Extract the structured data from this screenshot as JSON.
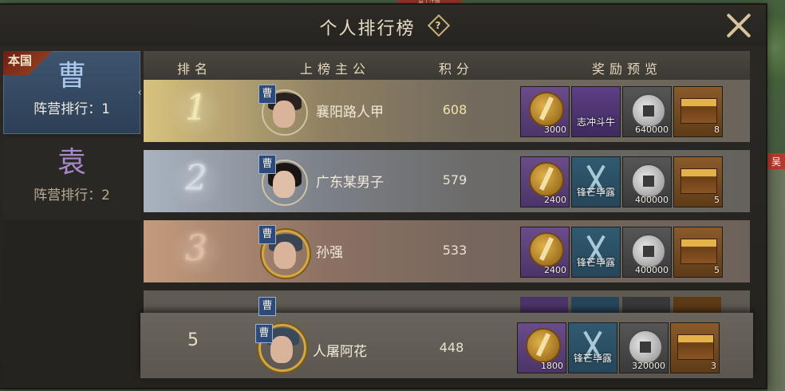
{
  "map": {
    "right_tag": "吴",
    "top_tag": "吴 | 江南"
  },
  "header": {
    "title": "个人排行榜",
    "help_symbol": "?"
  },
  "tabs": [
    {
      "ribbon": "本国",
      "glyph": "曹",
      "rank_text": "阵营排行：1",
      "active": true
    },
    {
      "glyph": "袁",
      "rank_text": "阵营排行：2",
      "active": false
    }
  ],
  "columns": {
    "rank": "排名",
    "lord": "上榜主公",
    "score": "积分",
    "rewards": "奖励预览"
  },
  "rows": [
    {
      "rank": "1",
      "faction": "曹",
      "name": "襄阳路人甲",
      "score": "608",
      "rewards": {
        "token_qty": "3000",
        "item2_text": "志冲斗牛",
        "coin_qty": "640000",
        "chest_qty": "8"
      }
    },
    {
      "rank": "2",
      "faction": "曹",
      "name": "广东某男子",
      "score": "579",
      "rewards": {
        "token_qty": "2400",
        "item2_text": "锋芒毕露",
        "coin_qty": "400000",
        "chest_qty": "5"
      }
    },
    {
      "rank": "3",
      "faction": "曹",
      "name": "孙强",
      "score": "533",
      "rewards": {
        "token_qty": "2400",
        "item2_text": "锋芒毕露",
        "coin_qty": "400000",
        "chest_qty": "5"
      }
    },
    {
      "rank": "",
      "faction": "曹",
      "name": "",
      "score": ""
    }
  ],
  "self_row": {
    "rank": "5",
    "faction": "曹",
    "name": "人屠阿花",
    "score": "448",
    "rewards": {
      "token_qty": "1800",
      "item2_text": "锋芒毕露",
      "coin_qty": "320000",
      "chest_qty": "3"
    }
  },
  "colors": {
    "camp_cao": "#2e4a78",
    "camp_yuan": "#a789c9",
    "gold": "#f2e3a8"
  }
}
